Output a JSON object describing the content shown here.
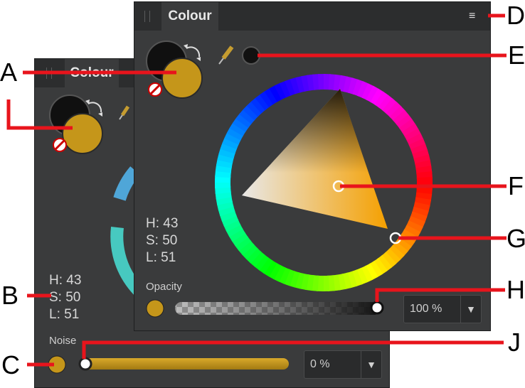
{
  "colors": {
    "primary": "#c5961a",
    "secondary": "#101010",
    "panel_bg": "#3a3b3c",
    "callout_line": "#e8141c"
  },
  "back_panel": {
    "tab_label": "Colour",
    "hsl": {
      "h": "H: 43",
      "s": "S: 50",
      "l": "L: 51"
    },
    "noise_label": "Noise",
    "noise_value": "0 %"
  },
  "front_panel": {
    "tab_label": "Colour",
    "menu_icon": "panel-menu-icon",
    "hsl": {
      "h": "H: 43",
      "s": "S: 50",
      "l": "L: 51"
    },
    "opacity_label": "Opacity",
    "opacity_value": "100 %"
  },
  "callouts": {
    "a": "A",
    "b": "B",
    "c": "C",
    "d": "D",
    "e": "E",
    "f": "F",
    "g": "G",
    "h": "H",
    "j": "J"
  }
}
